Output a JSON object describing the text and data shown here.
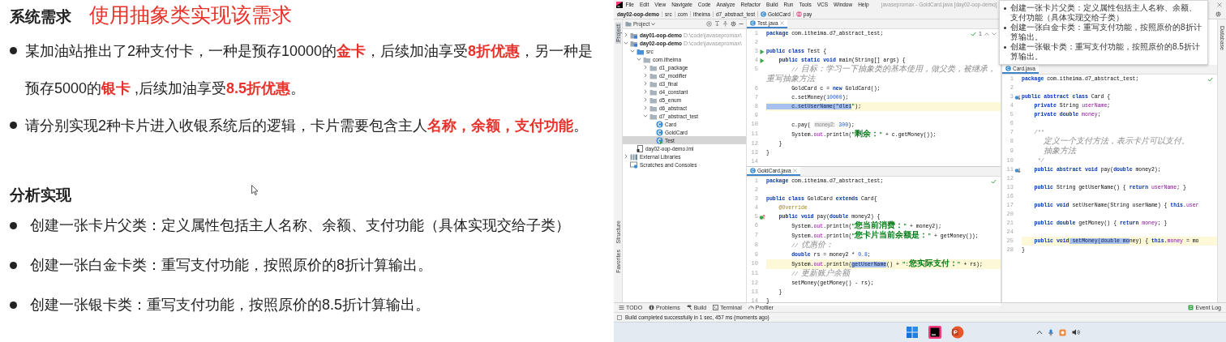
{
  "slide": {
    "heading": "系统需求",
    "title": "使用抽象类实现该需求",
    "requirements": [
      "某加油站推出了2种支付卡，一种是预存10000的**金卡**，后续加油享受**8折优惠**，另一种是预存5000的**银卡** ,后续加油享受**8.5折优惠**。",
      "请分别实现2种卡片进入收银系统后的逻辑，卡片需要包含主人**名称，余额，支付功能**。"
    ],
    "analysis_heading": "分析实现",
    "analysis_items": [
      "创建一张卡片父类：定义属性包括主人名称、余额、支付功能（具体实现交给子类）",
      "创建一张白金卡类：重写支付功能，按照原价的8折计算输出。",
      "创建一张银卡类：重写支付功能，按照原价的8.5折计算输出。"
    ]
  },
  "ide": {
    "menu": [
      "File",
      "Edit",
      "View",
      "Navigate",
      "Code",
      "Analyze",
      "Refactor",
      "Build",
      "Run",
      "Tools",
      "VCS",
      "Window",
      "Help"
    ],
    "window_title": "javasepromax - GoldCard.java [day02-oop-demo]",
    "breadcrumbs": [
      {
        "label": "day02-oop-demo",
        "kind": "project"
      },
      {
        "label": "src",
        "kind": "folder"
      },
      {
        "label": "com",
        "kind": "folder"
      },
      {
        "label": "itheima",
        "kind": "folder"
      },
      {
        "label": "d7_abstract_test",
        "kind": "folder"
      },
      {
        "label": "GoldCard",
        "kind": "class"
      },
      {
        "label": "pay",
        "kind": "method"
      }
    ],
    "left_tool_strip": [
      {
        "label": "Project",
        "kind": "top",
        "selected": true
      },
      {
        "label": "Structure",
        "kind": "bottom",
        "selected": false
      },
      {
        "label": "Favorites",
        "kind": "bottom",
        "selected": false
      }
    ],
    "right_tool_strip": [
      "Database"
    ],
    "project_panel": {
      "title": "Project",
      "tree": [
        {
          "label": "day01-oop-demo",
          "path": "D:\\code\\javasepromax\\",
          "kind": "module",
          "expanded": false,
          "selected": false
        },
        {
          "label": "day02-oop-demo",
          "path": "D:\\code\\javasepromax\\",
          "kind": "module",
          "expanded": true,
          "selected": false,
          "children": [
            {
              "label": "src",
              "kind": "source",
              "expanded": true,
              "selected": false,
              "children": [
                {
                  "label": "com.itheima",
                  "kind": "package",
                  "expanded": true,
                  "selected": false,
                  "children": [
                    {
                      "label": "d1_package",
                      "kind": "package",
                      "expanded": false,
                      "selected": false
                    },
                    {
                      "label": "d2_modifier",
                      "kind": "package",
                      "expanded": false,
                      "selected": false
                    },
                    {
                      "label": "d3_final",
                      "kind": "package",
                      "expanded": false,
                      "selected": false
                    },
                    {
                      "label": "d4_constant",
                      "kind": "package",
                      "expanded": false,
                      "selected": false
                    },
                    {
                      "label": "d5_enum",
                      "kind": "package",
                      "expanded": false,
                      "selected": false
                    },
                    {
                      "label": "d6_abstract",
                      "kind": "package",
                      "expanded": false,
                      "selected": false
                    },
                    {
                      "label": "d7_abstract_test",
                      "kind": "package",
                      "expanded": true,
                      "selected": false,
                      "children": [
                        {
                          "label": "Card",
                          "kind": "class",
                          "selected": false
                        },
                        {
                          "label": "GoldCard",
                          "kind": "class",
                          "selected": false
                        },
                        {
                          "label": "Test",
                          "kind": "runnable",
                          "selected": true
                        }
                      ]
                    }
                  ]
                }
              ]
            },
            {
              "label": "day02-oop-demo.iml",
              "kind": "iml",
              "selected": false
            }
          ]
        },
        {
          "label": "External Libraries",
          "kind": "libraries",
          "expanded": false,
          "selected": false
        },
        {
          "label": "Scratches and Consoles",
          "kind": "scratches",
          "selected": false
        }
      ]
    },
    "editors": [
      {
        "file": "Test.java",
        "inspection": "1",
        "lines": [
          {
            "number": "1",
            "current": false,
            "segments": [
              {
                "kind": "keyword",
                "text": "package"
              },
              {
                "kind": "plain",
                "text": " com.itheima.d7_abstract_test;"
              }
            ]
          },
          {
            "number": "2",
            "current": false
          },
          {
            "number": "3",
            "current": false,
            "gutter": {
              "kind": "run"
            },
            "segments": [
              {
                "kind": "keyword",
                "text": "public class"
              },
              {
                "kind": "plain",
                "text": " Test {"
              }
            ]
          },
          {
            "number": "4",
            "current": false,
            "gutter": {
              "kind": "run"
            },
            "segments": [
              {
                "kind": "keyword",
                "text": "    public static void"
              },
              {
                "kind": "plain",
                "text": " main(String[] args) {"
              }
            ]
          },
          {
            "number": "5",
            "current": false,
            "segments": [
              {
                "kind": "comment",
                "text": "        // 目标：学习一下抽象类的基本使用，做父类，被继承，重写抽象方法"
              }
            ]
          },
          {
            "number": "6",
            "current": false,
            "segments": [
              {
                "kind": "plain",
                "text": "        GoldCard c = "
              },
              {
                "kind": "keyword",
                "text": "new"
              },
              {
                "kind": "plain",
                "text": " GoldCard();"
              }
            ]
          },
          {
            "number": "7",
            "current": false,
            "segments": [
              {
                "kind": "plain",
                "text": "        c.setMoney("
              },
              {
                "kind": "number",
                "text": "10000"
              },
              {
                "kind": "plain",
                "text": ");"
              }
            ]
          },
          {
            "number": "8",
            "current": true,
            "segments": [
              {
                "kind": "selection",
                "text": "        c.setUserName(\"dlei"
              },
              {
                "kind": "string",
                "text": "\""
              },
              {
                "kind": "plain",
                "text": ");"
              }
            ]
          },
          {
            "number": "9",
            "current": false
          },
          {
            "number": "10",
            "current": false,
            "segments": [
              {
                "kind": "plain",
                "text": "        c.pay( "
              },
              {
                "kind": "hint",
                "text": "money2:"
              },
              {
                "kind": "number",
                "text": " 300"
              },
              {
                "kind": "plain",
                "text": ");"
              }
            ]
          },
          {
            "number": "11",
            "current": false,
            "segments": [
              {
                "kind": "plain",
                "text": "        System."
              },
              {
                "kind": "field",
                "text": "out"
              },
              {
                "kind": "plain",
                "text": ".println("
              },
              {
                "kind": "string",
                "text": "\"剩余：\""
              },
              {
                "kind": "plain",
                "text": " + c.getMoney());"
              }
            ]
          },
          {
            "number": "12",
            "current": false,
            "segments": [
              {
                "kind": "plain",
                "text": "    }"
              }
            ]
          },
          {
            "number": "13",
            "current": false,
            "segments": [
              {
                "kind": "plain",
                "text": "}"
              }
            ]
          },
          {
            "number": "14",
            "current": false
          }
        ]
      },
      {
        "file": "GoldCard.java",
        "lines": [
          {
            "number": "1",
            "current": false,
            "segments": [
              {
                "kind": "keyword",
                "text": "package"
              },
              {
                "kind": "plain",
                "text": " com.itheima.d7_abstract_test;"
              }
            ]
          },
          {
            "number": "2",
            "current": false
          },
          {
            "number": "3",
            "current": false,
            "segments": [
              {
                "kind": "keyword",
                "text": "public class"
              },
              {
                "kind": "plain",
                "text": " GoldCard "
              },
              {
                "kind": "keyword",
                "text": "extends"
              },
              {
                "kind": "plain",
                "text": " Card{"
              }
            ]
          },
          {
            "number": "4",
            "current": false,
            "segments": [
              {
                "kind": "annotation",
                "text": "    @Override"
              }
            ]
          },
          {
            "number": "5",
            "current": false,
            "gutter": {
              "kind": "overriding"
            },
            "segments": [
              {
                "kind": "keyword",
                "text": "    public void"
              },
              {
                "kind": "plain",
                "text": " pay("
              },
              {
                "kind": "keyword",
                "text": "double"
              },
              {
                "kind": "plain",
                "text": " money2) {"
              }
            ]
          },
          {
            "number": "6",
            "current": false,
            "segments": [
              {
                "kind": "plain",
                "text": "        System."
              },
              {
                "kind": "field",
                "text": "out"
              },
              {
                "kind": "plain",
                "text": ".println("
              },
              {
                "kind": "string",
                "text": "\"您当前消费：\""
              },
              {
                "kind": "plain",
                "text": " + money2);"
              }
            ]
          },
          {
            "number": "7",
            "current": false,
            "segments": [
              {
                "kind": "plain",
                "text": "        System."
              },
              {
                "kind": "field",
                "text": "out"
              },
              {
                "kind": "plain",
                "text": ".println("
              },
              {
                "kind": "string",
                "text": "\"您卡片当前余额是：\""
              },
              {
                "kind": "plain",
                "text": " + getMoney());"
              }
            ]
          },
          {
            "number": "8",
            "current": false,
            "segments": [
              {
                "kind": "comment",
                "text": "        // 优惠价："
              }
            ]
          },
          {
            "number": "9",
            "current": false,
            "segments": [
              {
                "kind": "keyword",
                "text": "        double"
              },
              {
                "kind": "plain",
                "text": " rs = money2 * "
              },
              {
                "kind": "number",
                "text": "0.8"
              },
              {
                "kind": "plain",
                "text": ";"
              }
            ]
          },
          {
            "number": "10",
            "current": true,
            "segments": [
              {
                "kind": "plain",
                "text": "        System."
              },
              {
                "kind": "field",
                "text": "out"
              },
              {
                "kind": "plain",
                "text": ".println("
              },
              {
                "kind": "selection",
                "text": "getUserName"
              },
              {
                "kind": "plain",
                "text": "() + "
              },
              {
                "kind": "string",
                "text": "\":您实际支付：\""
              },
              {
                "kind": "plain",
                "text": " + rs);"
              }
            ]
          },
          {
            "number": "11",
            "current": false,
            "segments": [
              {
                "kind": "comment",
                "text": "        // 更新账户余额"
              }
            ]
          },
          {
            "number": "12",
            "current": false,
            "segments": [
              {
                "kind": "plain",
                "text": "        setMoney(getMoney() - rs);"
              }
            ]
          },
          {
            "number": "13",
            "current": false,
            "segments": [
              {
                "kind": "plain",
                "text": "    }"
              }
            ]
          },
          {
            "number": "14",
            "current": false,
            "segments": [
              {
                "kind": "plain",
                "text": "}"
              }
            ]
          }
        ]
      },
      {
        "file": "Card.java",
        "lines": [
          {
            "number": "1",
            "current": false,
            "segments": [
              {
                "kind": "keyword",
                "text": "package"
              },
              {
                "kind": "plain",
                "text": " com.itheima.d7_abstract_test;"
              }
            ]
          },
          {
            "number": "2",
            "current": false
          },
          {
            "number": "3",
            "current": false,
            "gutter": {
              "kind": "implemented"
            },
            "segments": [
              {
                "kind": "keyword",
                "text": "public abstract class"
              },
              {
                "kind": "plain",
                "text": " Card {"
              }
            ]
          },
          {
            "number": "4",
            "current": false,
            "segments": [
              {
                "kind": "keyword",
                "text": "    private"
              },
              {
                "kind": "plain",
                "text": " String "
              },
              {
                "kind": "field",
                "text": "userName"
              },
              {
                "kind": "plain",
                "text": ";"
              }
            ]
          },
          {
            "number": "5",
            "current": false,
            "segments": [
              {
                "kind": "keyword",
                "text": "    private double"
              },
              {
                "kind": "field",
                "text": " money"
              },
              {
                "kind": "plain",
                "text": ";"
              }
            ]
          },
          {
            "number": "6",
            "current": false
          },
          {
            "number": "7",
            "current": false,
            "segments": [
              {
                "kind": "comment",
                "text": "    /**"
              }
            ]
          },
          {
            "number": "8",
            "current": false,
            "segments": [
              {
                "kind": "comment",
                "text": "       定义一个支付方法，表示卡片可以支付。"
              }
            ]
          },
          {
            "number": "9",
            "current": false,
            "segments": [
              {
                "kind": "comment",
                "text": "       抽象方法"
              }
            ]
          },
          {
            "number": "10",
            "current": false,
            "segments": [
              {
                "kind": "comment",
                "text": "     */"
              }
            ]
          },
          {
            "number": "11",
            "current": false,
            "gutter": {
              "kind": "implemented"
            },
            "segments": [
              {
                "kind": "keyword",
                "text": "    public abstract void"
              },
              {
                "kind": "plain",
                "text": " pay("
              },
              {
                "kind": "keyword",
                "text": "double"
              },
              {
                "kind": "plain",
                "text": " money2);"
              }
            ]
          },
          {
            "number": "12",
            "current": false
          },
          {
            "number": "13",
            "current": false,
            "segments": [
              {
                "kind": "keyword",
                "text": "    public"
              },
              {
                "kind": "plain",
                "text": " String getUserName() { "
              },
              {
                "kind": "keyword",
                "text": "return"
              },
              {
                "kind": "field",
                "text": " userName"
              },
              {
                "kind": "plain",
                "text": "; }"
              }
            ]
          },
          {
            "number": "16",
            "current": false
          },
          {
            "number": "17",
            "current": false,
            "segments": [
              {
                "kind": "keyword",
                "text": "    public void"
              },
              {
                "kind": "plain",
                "text": " setUserName(String userName) { "
              },
              {
                "kind": "keyword",
                "text": "this"
              },
              {
                "kind": "plain",
                "text": "."
              },
              {
                "kind": "field",
                "text": "user"
              }
            ]
          },
          {
            "number": "20",
            "current": false
          },
          {
            "number": "21",
            "current": false,
            "segments": [
              {
                "kind": "keyword",
                "text": "    public double"
              },
              {
                "kind": "plain",
                "text": " getMoney() { "
              },
              {
                "kind": "keyword",
                "text": "return"
              },
              {
                "kind": "field",
                "text": " money"
              },
              {
                "kind": "plain",
                "text": "; }"
              }
            ]
          },
          {
            "number": "24",
            "current": false
          },
          {
            "number": "25",
            "current": true,
            "segments": [
              {
                "kind": "keyword",
                "text": "    public void"
              },
              {
                "kind": "selection",
                "text": " setMoney(double mo"
              },
              {
                "kind": "plain",
                "text": "ney) { "
              },
              {
                "kind": "keyword",
                "text": "this"
              },
              {
                "kind": "plain",
                "text": "."
              },
              {
                "kind": "field",
                "text": "money"
              },
              {
                "kind": "plain",
                "text": " = mo"
              }
            ]
          },
          {
            "number": "28",
            "current": false,
            "segments": [
              {
                "kind": "plain",
                "text": "}"
              }
            ]
          }
        ]
      }
    ],
    "popup": {
      "items": [
        "创建一张卡片父类：定义属性包括主人名称、余额、支付功能（具体实现交给子类）",
        "创建一张白金卡类：重写支付功能，按照原价的8折计算输出。",
        "创建一张银卡类：重写支付功能，按照原价的8.5折计算输出。"
      ]
    },
    "tool_windows": [
      {
        "label": "TODO",
        "kind": "todo"
      },
      {
        "label": "Problems",
        "kind": "problems"
      },
      {
        "label": "Build",
        "kind": "build"
      },
      {
        "label": "Terminal",
        "kind": "terminal"
      },
      {
        "label": "Profiler",
        "kind": "profiler"
      }
    ],
    "event_log": "Event Log",
    "status": "Build completed successfully in 1 sec, 457 ms (moments ago)"
  },
  "taskbar": {
    "apps": [
      {
        "kind": "start"
      },
      {
        "kind": "ide"
      },
      {
        "kind": "presentation"
      }
    ],
    "tray": [
      {
        "kind": "chevron"
      },
      {
        "kind": "microphone"
      },
      {
        "kind": "app"
      },
      {
        "kind": "speaker"
      }
    ]
  }
}
